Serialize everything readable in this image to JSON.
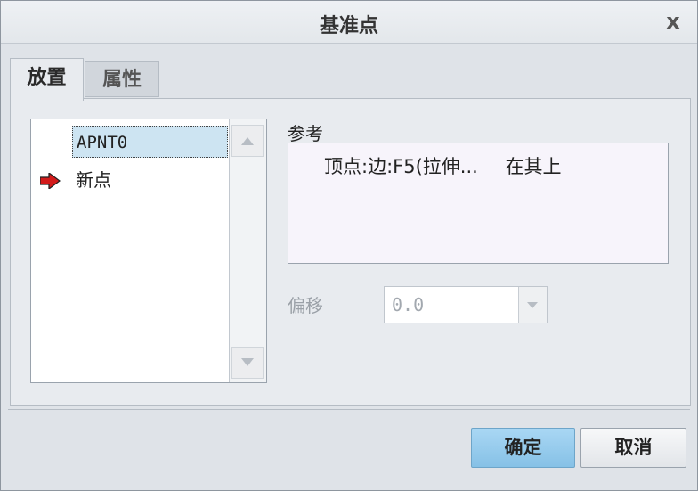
{
  "window": {
    "title": "基准点",
    "close_label": "x"
  },
  "tabs": [
    {
      "label": "放置",
      "active": true
    },
    {
      "label": "属性",
      "active": false
    }
  ],
  "points_list": {
    "items": [
      {
        "label": "APNT0",
        "selected": true
      },
      {
        "label": "新点",
        "selected": false,
        "icon": "red-arrow-icon"
      }
    ]
  },
  "reference": {
    "label": "参考",
    "rows": [
      {
        "entity": "顶点:边:F5(拉伸...",
        "constraint": "在其上"
      }
    ]
  },
  "offset": {
    "label": "偏移",
    "value": "0.0",
    "enabled": false
  },
  "buttons": {
    "ok": "确定",
    "cancel": "取消"
  },
  "colors": {
    "accent": "#86c1e6",
    "selection": "#cde4f2",
    "arrow": "#d31b1b"
  }
}
